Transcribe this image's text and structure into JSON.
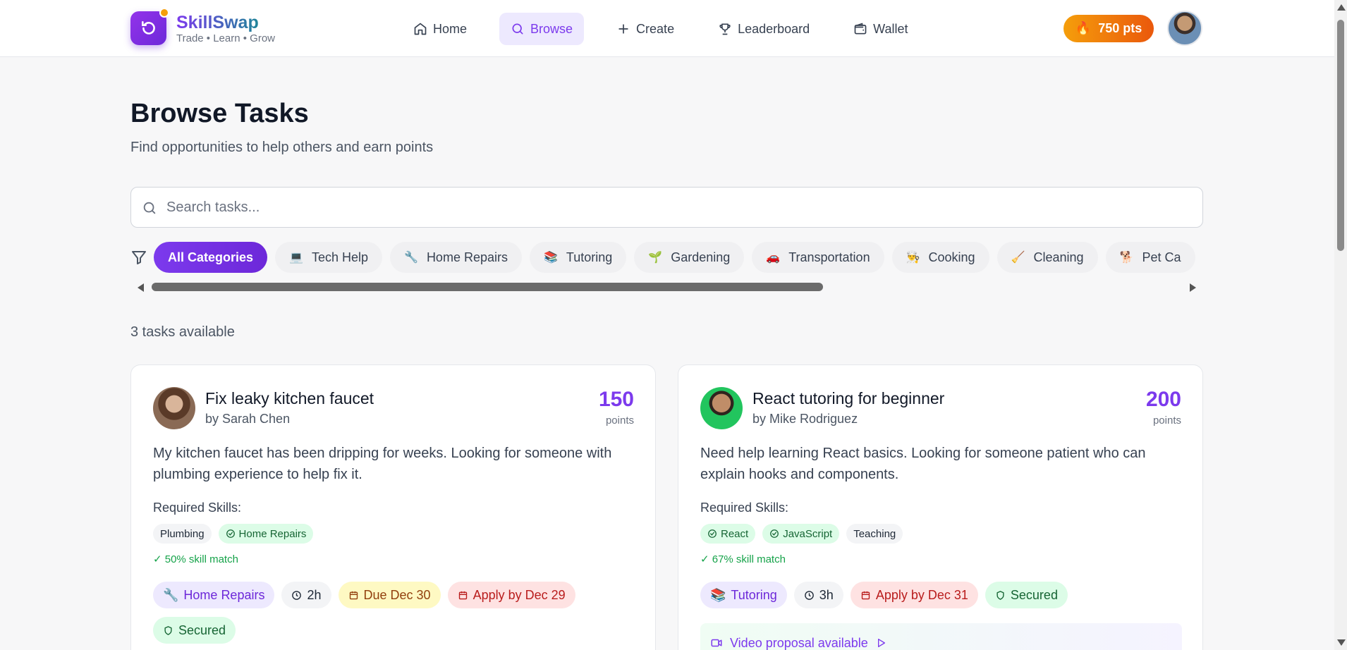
{
  "brand": {
    "name": "SkillSwap",
    "tagline": "Trade • Learn • Grow"
  },
  "nav": [
    {
      "label": "Home",
      "icon": "home-icon"
    },
    {
      "label": "Browse",
      "icon": "search-icon",
      "active": true
    },
    {
      "label": "Create",
      "icon": "plus-icon"
    },
    {
      "label": "Leaderboard",
      "icon": "trophy-icon"
    },
    {
      "label": "Wallet",
      "icon": "wallet-icon"
    }
  ],
  "points_badge": {
    "emoji": "🔥",
    "label": "750 pts"
  },
  "page": {
    "title": "Browse Tasks",
    "subtitle": "Find opportunities to help others and earn points"
  },
  "search": {
    "placeholder": "Search tasks..."
  },
  "categories": [
    {
      "emoji": "",
      "label": "All Categories",
      "active": true
    },
    {
      "emoji": "💻",
      "label": "Tech Help"
    },
    {
      "emoji": "🔧",
      "label": "Home Repairs"
    },
    {
      "emoji": "📚",
      "label": "Tutoring"
    },
    {
      "emoji": "🌱",
      "label": "Gardening"
    },
    {
      "emoji": "🚗",
      "label": "Transportation"
    },
    {
      "emoji": "👨‍🍳",
      "label": "Cooking"
    },
    {
      "emoji": "🧹",
      "label": "Cleaning"
    },
    {
      "emoji": "🐕",
      "label": "Pet Ca"
    }
  ],
  "task_count": "3 tasks available",
  "tasks": [
    {
      "title": "Fix leaky kitchen faucet",
      "author": "by Sarah Chen",
      "points": "150",
      "points_label": "points",
      "description": "My kitchen faucet has been dripping for weeks. Looking for someone with plumbing experience to help fix it.",
      "required_label": "Required Skills:",
      "skills": [
        {
          "label": "Plumbing",
          "matched": false
        },
        {
          "label": "Home Repairs",
          "matched": true
        }
      ],
      "match": "✓ 50% skill match",
      "category_tag": {
        "emoji": "🔧",
        "label": "Home Repairs"
      },
      "duration": "2h",
      "due": "Due Dec 30",
      "apply_by": "Apply by Dec 29",
      "secured": "Secured"
    },
    {
      "title": "React tutoring for beginner",
      "author": "by Mike Rodriguez",
      "points": "200",
      "points_label": "points",
      "description": "Need help learning React basics. Looking for someone patient who can explain hooks and components.",
      "required_label": "Required Skills:",
      "skills": [
        {
          "label": "React",
          "matched": true
        },
        {
          "label": "JavaScript",
          "matched": true
        },
        {
          "label": "Teaching",
          "matched": false
        }
      ],
      "match": "✓ 67% skill match",
      "category_tag": {
        "emoji": "📚",
        "label": "Tutoring"
      },
      "duration": "3h",
      "apply_by": "Apply by Dec 31",
      "secured": "Secured",
      "video": "Video proposal available"
    }
  ],
  "colors": {
    "accent": "#7c3aed",
    "points_gradient_start": "#f59e0b",
    "points_gradient_end": "#ea580c",
    "match_green": "#16a34a"
  }
}
